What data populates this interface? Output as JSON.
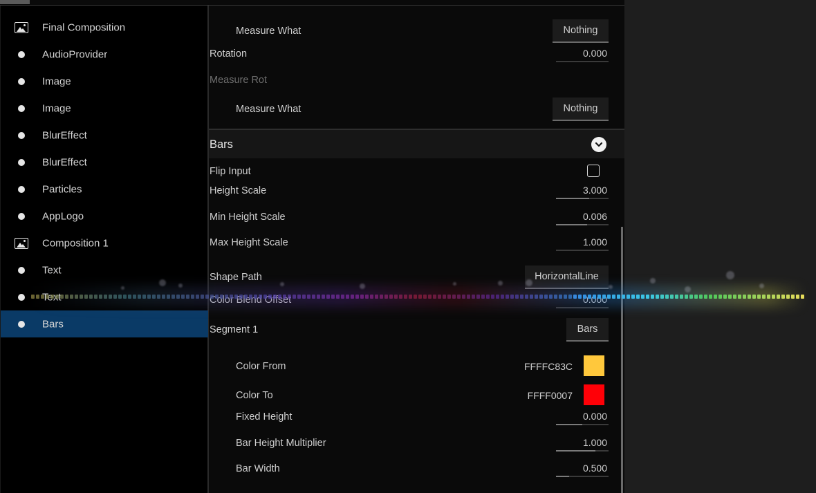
{
  "layers": [
    {
      "label": "Final Composition",
      "icon": "image-icon"
    },
    {
      "label": "AudioProvider",
      "icon": "dot-icon"
    },
    {
      "label": "Image",
      "icon": "dot-icon"
    },
    {
      "label": "Image",
      "icon": "dot-icon"
    },
    {
      "label": "BlurEffect",
      "icon": "dot-icon"
    },
    {
      "label": "BlurEffect",
      "icon": "dot-icon"
    },
    {
      "label": "Particles",
      "icon": "dot-icon"
    },
    {
      "label": "AppLogo",
      "icon": "dot-icon"
    },
    {
      "label": "Composition 1",
      "icon": "image-icon"
    },
    {
      "label": "Text",
      "icon": "dot-icon"
    },
    {
      "label": "Text",
      "icon": "dot-icon"
    },
    {
      "label": "Bars",
      "icon": "dot-icon",
      "selected": true
    }
  ],
  "inspector": {
    "measure_what_1": {
      "label": "Measure What",
      "value": "Nothing"
    },
    "rotation": {
      "label": "Rotation",
      "value": "0.000",
      "level": 0
    },
    "measure_rot": {
      "label": "Measure Rot"
    },
    "measure_what_2": {
      "label": "Measure What",
      "value": "Nothing"
    },
    "bars_section": {
      "title": "Bars",
      "icon": "chevron-down-icon"
    },
    "flip_input": {
      "label": "Flip Input",
      "checked": false
    },
    "height_scale": {
      "label": "Height Scale",
      "value": "3.000",
      "level": 0.63
    },
    "min_height_scale": {
      "label": "Min Height Scale",
      "value": "0.006",
      "level": 0.6
    },
    "max_height_scale": {
      "label": "Max Height Scale",
      "value": "1.000",
      "level": 0
    },
    "shape_path": {
      "label": "Shape Path",
      "value": "HorizontalLine"
    },
    "color_blend_offset": {
      "label": "Color Blend Offset",
      "value": "0.000",
      "level": 0
    },
    "segment_1": {
      "label": "Segment 1",
      "value": "Bars"
    },
    "color_from": {
      "label": "Color From",
      "hex": "FFFFC83C",
      "color": "#FFC83C"
    },
    "color_to": {
      "label": "Color To",
      "hex": "FFFF0007",
      "color": "#FF0007"
    },
    "fixed_height": {
      "label": "Fixed Height",
      "value": "0.000",
      "level": 0.5
    },
    "bar_height_multiplier": {
      "label": "Bar Height Multiplier",
      "value": "1.000",
      "level": 0.75
    },
    "bar_width": {
      "label": "Bar Width",
      "value": "0.500",
      "level": 0.25
    }
  },
  "colors": {
    "selection": "#0A3A66",
    "panel_bg": "#0A0A0A",
    "accent_yellow": "#FFC83C",
    "accent_red": "#FF0007"
  }
}
